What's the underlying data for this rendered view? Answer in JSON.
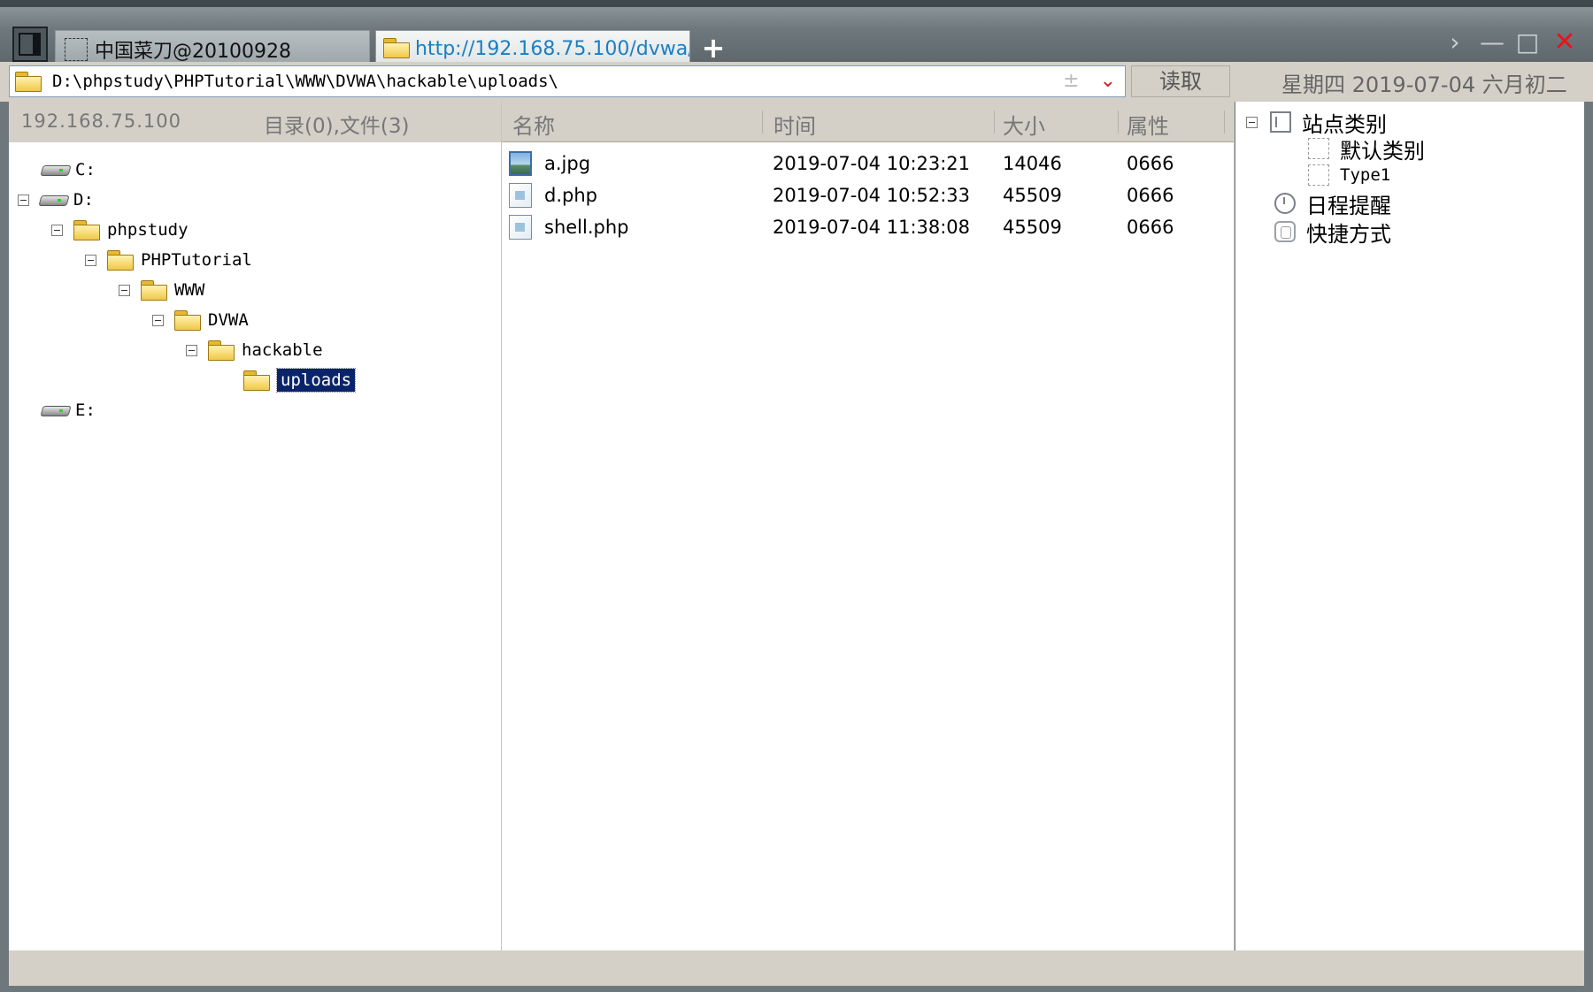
{
  "tabs": [
    {
      "label": "中国菜刀@20100928"
    },
    {
      "label": "http://192.168.75.100/dvwa/..."
    }
  ],
  "new_tab_label": "+",
  "window_controls": {
    "next": "›",
    "minimize": "—",
    "maximize": "□",
    "close": "✕"
  },
  "address": {
    "path": "D:\\phpstudy\\PHPTutorial\\WWW\\DVWA\\hackable\\uploads\\",
    "plus_glyph": "±",
    "dropdown_glyph": "⌄",
    "read_button": "读取"
  },
  "date_display": "星期四 2019-07-04 六月初二",
  "left_header": {
    "ip": "192.168.75.100",
    "counts": "目录(0),文件(3)"
  },
  "tree": {
    "drive_c": "C:",
    "drive_d": "D:",
    "phpstudy": "phpstudy",
    "phptutorial": "PHPTutorial",
    "www": "WWW",
    "dvwa": "DVWA",
    "hackable": "hackable",
    "uploads": "uploads",
    "drive_e": "E:"
  },
  "file_list": {
    "columns": {
      "name": "名称",
      "time": "时间",
      "size": "大小",
      "attr": "属性"
    },
    "rows": [
      {
        "name": "a.jpg",
        "time": "2019-07-04 10:23:21",
        "size": "14046",
        "attr": "0666",
        "icon": "image-file-icon"
      },
      {
        "name": "d.php",
        "time": "2019-07-04 10:52:33",
        "size": "45509",
        "attr": "0666",
        "icon": "php-file-icon"
      },
      {
        "name": "shell.php",
        "time": "2019-07-04 11:38:08",
        "size": "45509",
        "attr": "0666",
        "icon": "php-file-icon"
      }
    ]
  },
  "right_tree": {
    "site_category": "站点类别",
    "default_category": "默认类别",
    "type1": "Type1",
    "schedule": "日程提醒",
    "shortcuts": "快捷方式"
  },
  "colors": {
    "selection": "#0a246a",
    "tab_url": "#1a7fc4",
    "close": "#e8141a"
  }
}
